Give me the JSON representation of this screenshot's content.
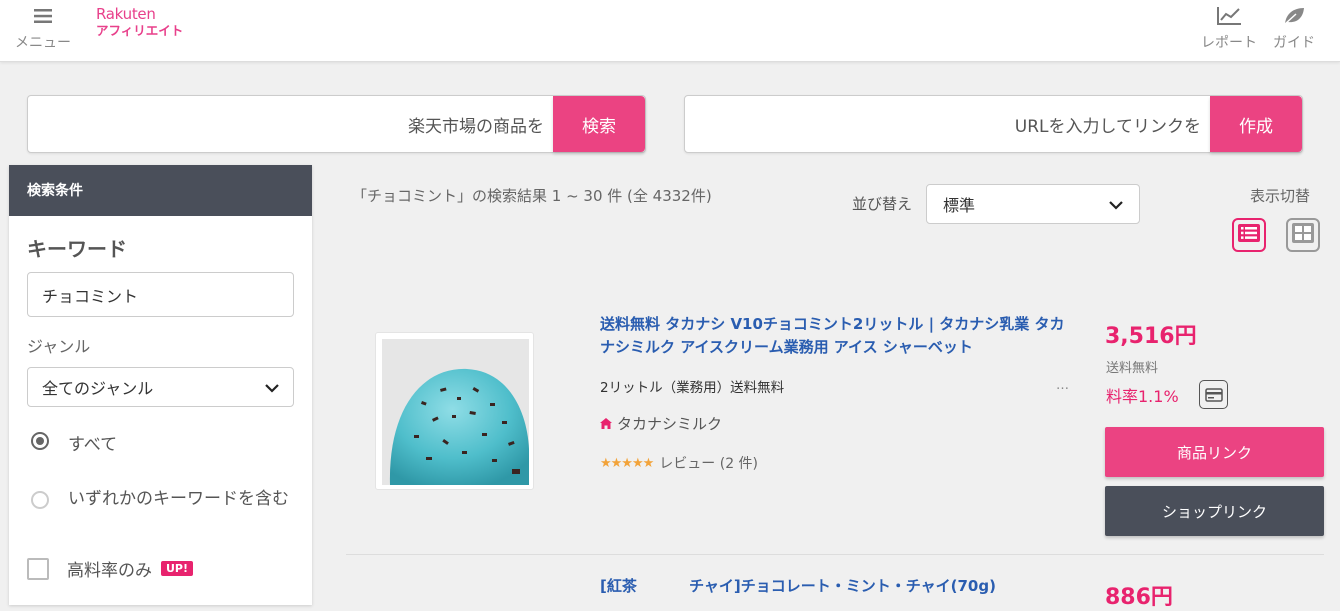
{
  "header": {
    "menu_label": "メニュー",
    "logo_line1": "Rakuten",
    "logo_line2": "アフィリエイト",
    "report_label": "レポート",
    "guide_label": "ガイド"
  },
  "product_search": {
    "placeholder": "楽天市場の商品を",
    "button": "検索"
  },
  "url_search": {
    "placeholder": "URLを入力してリンクを",
    "button": "作成"
  },
  "sidebar": {
    "title": "検索条件",
    "keyword_title": "キーワード",
    "keyword_value": "チョコミント",
    "genre_label": "ジャンル",
    "genre_value": "全てのジャンル",
    "radio_all": "すべて",
    "radio_any": "いずれかのキーワードを含む",
    "high_rate_label": "高料率のみ",
    "high_rate_badge": "UP!"
  },
  "results": {
    "summary": "「チョコミント」の検索結果 1 ~ 30 件 (全 4332件)",
    "sort_label": "並び替え",
    "sort_value": "標準",
    "view_label": "表示切替"
  },
  "items": [
    {
      "title": "送料無料 タカナシ V10チョコミント2リットル | タカナシ乳業 タカナシミルク アイスクリーム業務用 アイス シャーベット",
      "subtitle": "2リットル（業務用）送料無料",
      "more": "…",
      "shop": "タカナシミルク",
      "stars": "★★★★★",
      "review": "レビュー (2 件)",
      "price": "3,516円",
      "shipping": "送料無料",
      "rate": "料率1.1%",
      "product_link": "商品リンク",
      "shop_link": "ショップリンク"
    },
    {
      "title": "[紅茶          チャイ]チョコレート・ミント・チャイ(70g)",
      "price": "886円"
    }
  ],
  "colors": {
    "accent": "#eb4382",
    "dark": "#4a4f5a",
    "link": "#2a5db0"
  }
}
